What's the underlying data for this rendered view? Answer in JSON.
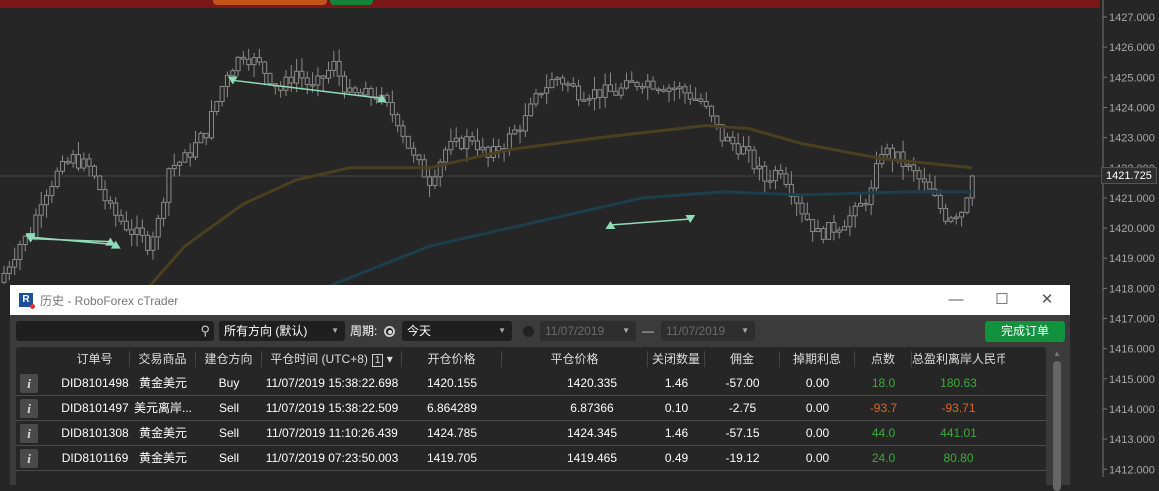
{
  "top_bar": {
    "colors": {
      "bar": "#7a1818",
      "pill1": "#c4521f",
      "pill2": "#14843a"
    }
  },
  "chart_data": {
    "type": "candlestick",
    "price_axis": {
      "ticks": [
        "1427.000",
        "1426.000",
        "1425.000",
        "1424.000",
        "1423.000",
        "1422.000",
        "1421.000",
        "1420.000",
        "1419.000",
        "1418.000",
        "1417.000",
        "1416.000",
        "1415.000",
        "1414.000",
        "1413.000",
        "1412.000"
      ],
      "range": [
        1411.8,
        1427.6
      ]
    },
    "current_price": "1421.725",
    "price_path": [
      [
        0,
        1418.5
      ],
      [
        3,
        1419.5
      ],
      [
        5,
        1419.8
      ],
      [
        7,
        1421
      ],
      [
        10,
        1421.8
      ],
      [
        13,
        1422.3
      ],
      [
        16,
        1422
      ],
      [
        20,
        1420.6
      ],
      [
        24,
        1419.9
      ],
      [
        27,
        1419.5
      ],
      [
        29,
        1420.2
      ],
      [
        31,
        1422
      ],
      [
        34,
        1422.3
      ],
      [
        38,
        1423.2
      ],
      [
        42,
        1425.2
      ],
      [
        45,
        1425.8
      ],
      [
        48,
        1425.4
      ],
      [
        52,
        1424.6
      ],
      [
        55,
        1425.2
      ],
      [
        58,
        1424.6
      ],
      [
        62,
        1425.4
      ],
      [
        65,
        1424.4
      ],
      [
        70,
        1424.4
      ],
      [
        74,
        1423.6
      ],
      [
        77,
        1422.3
      ],
      [
        80,
        1421.6
      ],
      [
        83,
        1422.6
      ],
      [
        88,
        1423
      ],
      [
        91,
        1422.3
      ],
      [
        95,
        1423
      ],
      [
        98,
        1423.6
      ],
      [
        101,
        1424.6
      ],
      [
        104,
        1425
      ],
      [
        108,
        1424.5
      ],
      [
        115,
        1424.5
      ],
      [
        120,
        1424.9
      ],
      [
        127,
        1424.6
      ],
      [
        131,
        1424.2
      ],
      [
        135,
        1423
      ],
      [
        139,
        1422.6
      ],
      [
        143,
        1421.6
      ],
      [
        146,
        1422
      ],
      [
        150,
        1420.6
      ],
      [
        153,
        1419.8
      ],
      [
        156,
        1420
      ],
      [
        160,
        1420.5
      ],
      [
        163,
        1421.2
      ],
      [
        165,
        1422.6
      ],
      [
        168,
        1422.3
      ],
      [
        171,
        1421.8
      ],
      [
        174,
        1421.2
      ],
      [
        177,
        1420.4
      ],
      [
        180,
        1420.6
      ],
      [
        182,
        1421.725
      ]
    ],
    "moving_averages": [
      {
        "name": "ma-slow",
        "color": "#4a3f1e",
        "points": [
          [
            27,
            1418
          ],
          [
            34,
            1419.4
          ],
          [
            45,
            1420.8
          ],
          [
            55,
            1421.6
          ],
          [
            65,
            1422
          ],
          [
            80,
            1422
          ],
          [
            95,
            1422.6
          ],
          [
            112,
            1423
          ],
          [
            132,
            1423.4
          ],
          [
            140,
            1423.3
          ],
          [
            150,
            1422.8
          ],
          [
            165,
            1422.3
          ],
          [
            182,
            1422
          ]
        ]
      },
      {
        "name": "ma-fast",
        "color": "#1d3e4c",
        "points": [
          [
            60,
            1418
          ],
          [
            80,
            1419.4
          ],
          [
            100,
            1420.2
          ],
          [
            120,
            1421
          ],
          [
            135,
            1421.2
          ],
          [
            150,
            1421.1
          ],
          [
            170,
            1421.2
          ],
          [
            182,
            1421.2
          ]
        ]
      }
    ],
    "trades": [
      {
        "from": [
          5,
          1419.65
        ],
        "to": [
          20,
          1419.55
        ],
        "entry": "sell",
        "exit": "buy"
      },
      {
        "from": [
          5,
          1419.7
        ],
        "to": [
          21,
          1419.45
        ],
        "entry": "sell",
        "exit": "buy"
      },
      {
        "from": [
          43,
          1424.9
        ],
        "to": [
          71,
          1424.3
        ],
        "entry": "sell",
        "exit": "buy"
      },
      {
        "from": [
          114,
          1420.1
        ],
        "to": [
          129,
          1420.3
        ],
        "entry": "buy",
        "exit": "sell"
      }
    ],
    "trade_color": "#8fdcb8"
  },
  "dialog": {
    "title": "历史 - RoboForex cTrader",
    "logo": "R",
    "window_buttons": {
      "minimize": "—",
      "maximize": "☐",
      "close": "✕"
    },
    "toolbar": {
      "search_value": "",
      "direction": "所有方向 (默认)",
      "period_label": "周期:",
      "period": "今天",
      "date_from": "11/07/2019",
      "date_sep": "—",
      "date_to": "11/07/2019",
      "done_button": "完成订单"
    },
    "columns": [
      "订单号",
      "交易商品",
      "建仓方向",
      "平仓时间 (UTC+8)",
      "开仓价格",
      "平仓价格",
      "关闭数量",
      "佣金",
      "掉期利息",
      "点数",
      "总盈利离岸人民币"
    ],
    "sort_badge": "1",
    "info_label": "i",
    "rows": [
      {
        "id": "DID8101498",
        "symbol": "黄金美元",
        "side": "Buy",
        "time": "11/07/2019 15:38:22.698",
        "open": "1420.155",
        "close": "1420.335",
        "qty": "1.46",
        "commission": "-57.00",
        "swap": "0.00",
        "pips": "18.0",
        "profit": "180.63",
        "sign": "pos"
      },
      {
        "id": "DID8101497",
        "symbol": "美元离岸...",
        "side": "Sell",
        "time": "11/07/2019 15:38:22.509",
        "open": "6.864289",
        "close": "6.87366",
        "qty": "0.10",
        "commission": "-2.75",
        "swap": "0.00",
        "pips": "-93.7",
        "profit": "-93.71",
        "sign": "neg"
      },
      {
        "id": "DID8101308",
        "symbol": "黄金美元",
        "side": "Sell",
        "time": "11/07/2019 11:10:26.439",
        "open": "1424.785",
        "close": "1424.345",
        "qty": "1.46",
        "commission": "-57.15",
        "swap": "0.00",
        "pips": "44.0",
        "profit": "441.01",
        "sign": "pos"
      },
      {
        "id": "DID8101169",
        "symbol": "黄金美元",
        "side": "Sell",
        "time": "11/07/2019 07:23:50.003",
        "open": "1419.705",
        "close": "1419.465",
        "qty": "0.49",
        "commission": "-19.12",
        "swap": "0.00",
        "pips": "24.0",
        "profit": "80.80",
        "sign": "pos"
      }
    ]
  }
}
